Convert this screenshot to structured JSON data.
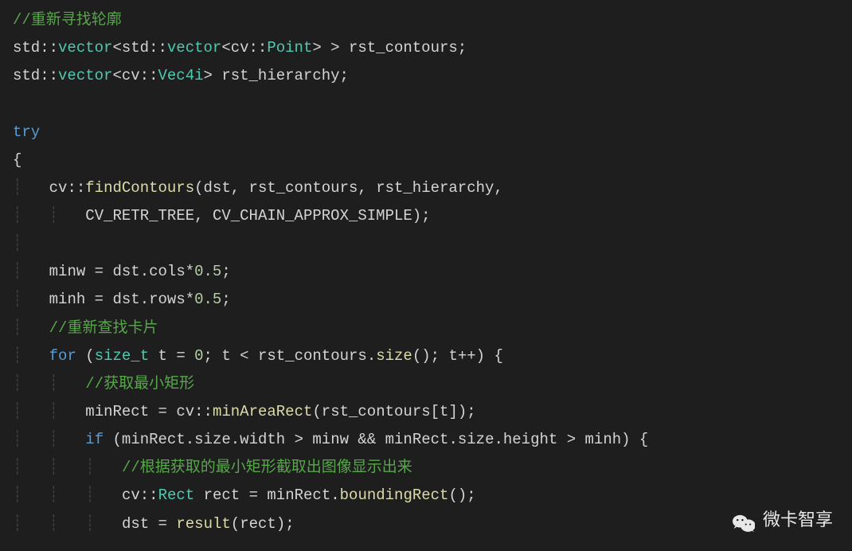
{
  "code": {
    "l1_comment": "//重新寻找轮廓",
    "l2": {
      "ns": "std",
      "vector": "vector",
      "ns2": "std",
      "vector2": "vector",
      "ns3": "cv",
      "point": "Point",
      "var": "rst_contours"
    },
    "l3": {
      "ns": "std",
      "vector": "vector",
      "ns2": "cv",
      "vec4i": "Vec4i",
      "var": "rst_hierarchy"
    },
    "l5_try": "try",
    "l8": {
      "ns": "cv",
      "func": "findContours",
      "arg1": "dst",
      "arg2": "rst_contours",
      "arg3": "rst_hierarchy"
    },
    "l9": {
      "arg4": "CV_RETR_TREE",
      "arg5": "CV_CHAIN_APPROX_SIMPLE"
    },
    "l11": {
      "lhs": "minw",
      "rhs1": "dst",
      "rhs2": "cols",
      "mult": "0.5"
    },
    "l12": {
      "lhs": "minh",
      "rhs1": "dst",
      "rhs2": "rows",
      "mult": "0.5"
    },
    "l13_comment": "//重新查找卡片",
    "l14": {
      "for": "for",
      "type": "size_t",
      "var": "t",
      "init": "0",
      "cond_var": "t",
      "cond_obj": "rst_contours",
      "cond_func": "size",
      "inc": "t"
    },
    "l15_comment": "//获取最小矩形",
    "l16": {
      "lhs": "minRect",
      "ns": "cv",
      "func": "minAreaRect",
      "arg": "rst_contours",
      "idx": "t"
    },
    "l17": {
      "if": "if",
      "v1": "minRect",
      "v2": "size",
      "v3": "width",
      "v4": "minw",
      "v5": "minRect",
      "v6": "size",
      "v7": "height",
      "v8": "minh"
    },
    "l18_comment": "//根据获取的最小矩形截取出图像显示出来",
    "l19": {
      "ns": "cv",
      "type": "Rect",
      "var": "rect",
      "obj": "minRect",
      "func": "boundingRect"
    },
    "l20": {
      "lhs": "dst",
      "func": "result",
      "arg": "rect"
    }
  },
  "watermark": {
    "text": "微卡智享"
  }
}
